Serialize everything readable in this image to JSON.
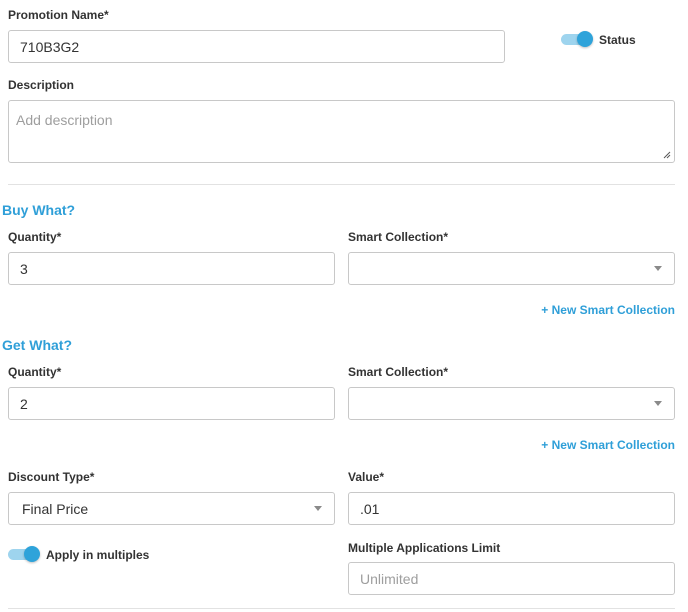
{
  "promotion": {
    "name_label": "Promotion Name*",
    "name_value": "710B3G2",
    "status_label": "Status",
    "description_label": "Description",
    "description_placeholder": "Add description"
  },
  "buy": {
    "title": "Buy What?",
    "quantity_label": "Quantity*",
    "quantity_value": "3",
    "collection_label": "Smart Collection*",
    "collection_value": "",
    "new_collection_link": "+ New Smart Collection"
  },
  "get": {
    "title": "Get What?",
    "quantity_label": "Quantity*",
    "quantity_value": "2",
    "collection_label": "Smart Collection*",
    "collection_value": "",
    "new_collection_link": "+ New Smart Collection"
  },
  "discount": {
    "type_label": "Discount Type*",
    "type_value": "Final Price",
    "value_label": "Value*",
    "value_value": ".01",
    "apply_multiples_label": "Apply in multiples",
    "limit_label": "Multiple Applications Limit",
    "limit_placeholder": "Unlimited"
  },
  "colors": {
    "accent": "#2f9fd8",
    "toggle_track": "#9ed4ee",
    "toggle_knob": "#2ea3da"
  },
  "icons": {
    "caret": "chevron-down-icon",
    "resize": "resize-grip-icon"
  }
}
